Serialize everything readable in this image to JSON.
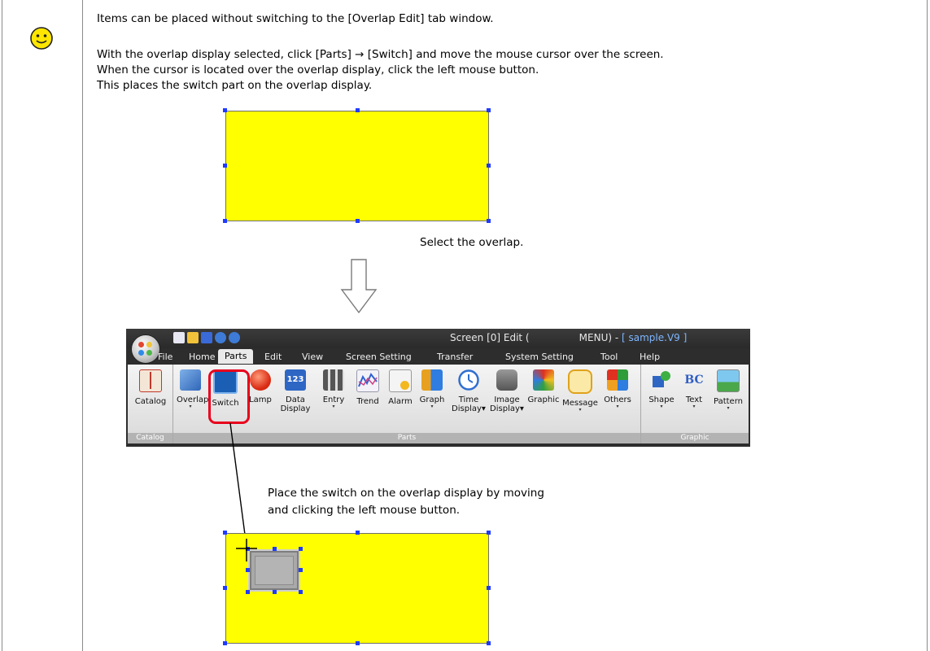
{
  "note": {
    "line1": "Items can be placed without switching to the [Overlap Edit] tab window.",
    "line2": "With the overlap display selected, click [Parts] → [Switch] and move the mouse cursor over the screen.",
    "line3": "When the cursor is located over the overlap display, click the left mouse button.",
    "line4": "This places the switch part on the overlap display."
  },
  "captions": {
    "select": "Select the overlap.",
    "place_line1": "Place the switch on the overlap display by moving",
    "place_line2": "and clicking the left mouse button."
  },
  "ribbon": {
    "title_prefix": "Screen [0] Edit (",
    "title_mid": "MENU) - ",
    "title_doc": "[ sample.V9 ]",
    "tabs": [
      "File",
      "Home",
      "Parts",
      "Edit",
      "View",
      "Screen Setting",
      "Transfer",
      "System Setting",
      "Tool",
      "Help"
    ],
    "active_tab": "Parts",
    "groups": [
      "Catalog",
      "Parts",
      "Graphic"
    ],
    "buttons": {
      "catalog": "Catalog",
      "overlap": "Overlap",
      "switch": "Switch",
      "lamp": "Lamp",
      "data_display_1": "Data",
      "data_display_2": "Display",
      "entry": "Entry",
      "trend": "Trend",
      "alarm": "Alarm",
      "graph": "Graph",
      "time_display_1": "Time",
      "time_display_2": "Display",
      "image_display_1": "Image",
      "image_display_2": "Display",
      "graphic": "Graphic",
      "message": "Message",
      "others": "Others",
      "shape": "Shape",
      "text": "Text",
      "pattern": "Pattern"
    },
    "data_display_icon_text": "123"
  },
  "colors": {
    "overlap_fill": "#ffff00",
    "handle": "#1f3bff",
    "highlight": "#e8001c",
    "smiley": "#ffe600"
  }
}
